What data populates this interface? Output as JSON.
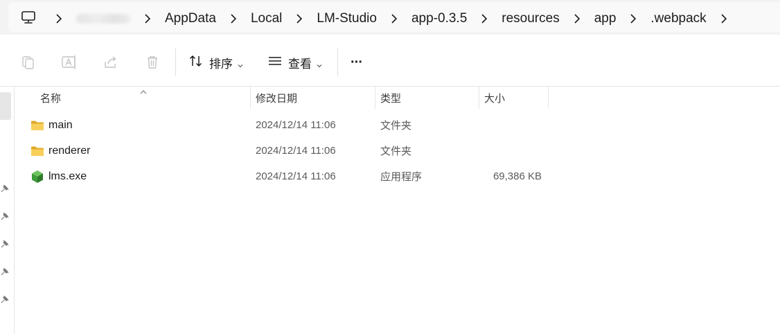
{
  "breadcrumbs": {
    "items": [
      {
        "label": ""
      },
      {
        "label": "AppData"
      },
      {
        "label": "Local"
      },
      {
        "label": "LM-Studio"
      },
      {
        "label": "app-0.3.5"
      },
      {
        "label": "resources"
      },
      {
        "label": "app"
      },
      {
        "label": ".webpack"
      }
    ]
  },
  "toolbar": {
    "sort_label": "排序",
    "view_label": "查看",
    "more_label": "···",
    "icons": [
      "copy-icon",
      "rename-icon",
      "share-icon",
      "delete-icon"
    ]
  },
  "columns": {
    "name": "名称",
    "modified": "修改日期",
    "type": "类型",
    "size": "大小"
  },
  "files": [
    {
      "name": "main",
      "modified": "2024/12/14 11:06",
      "type": "文件夹",
      "size": "",
      "icon": "folder-icon"
    },
    {
      "name": "renderer",
      "modified": "2024/12/14 11:06",
      "type": "文件夹",
      "size": "",
      "icon": "folder-icon"
    },
    {
      "name": "lms.exe",
      "modified": "2024/12/14 11:06",
      "type": "应用程序",
      "size": "69,386 KB",
      "icon": "exe-icon"
    }
  ],
  "colors": {
    "folder": "#f4c542",
    "folder_dark": "#e0a92a",
    "exe": "#3f9a3a",
    "accent": "#1b1b1b"
  }
}
